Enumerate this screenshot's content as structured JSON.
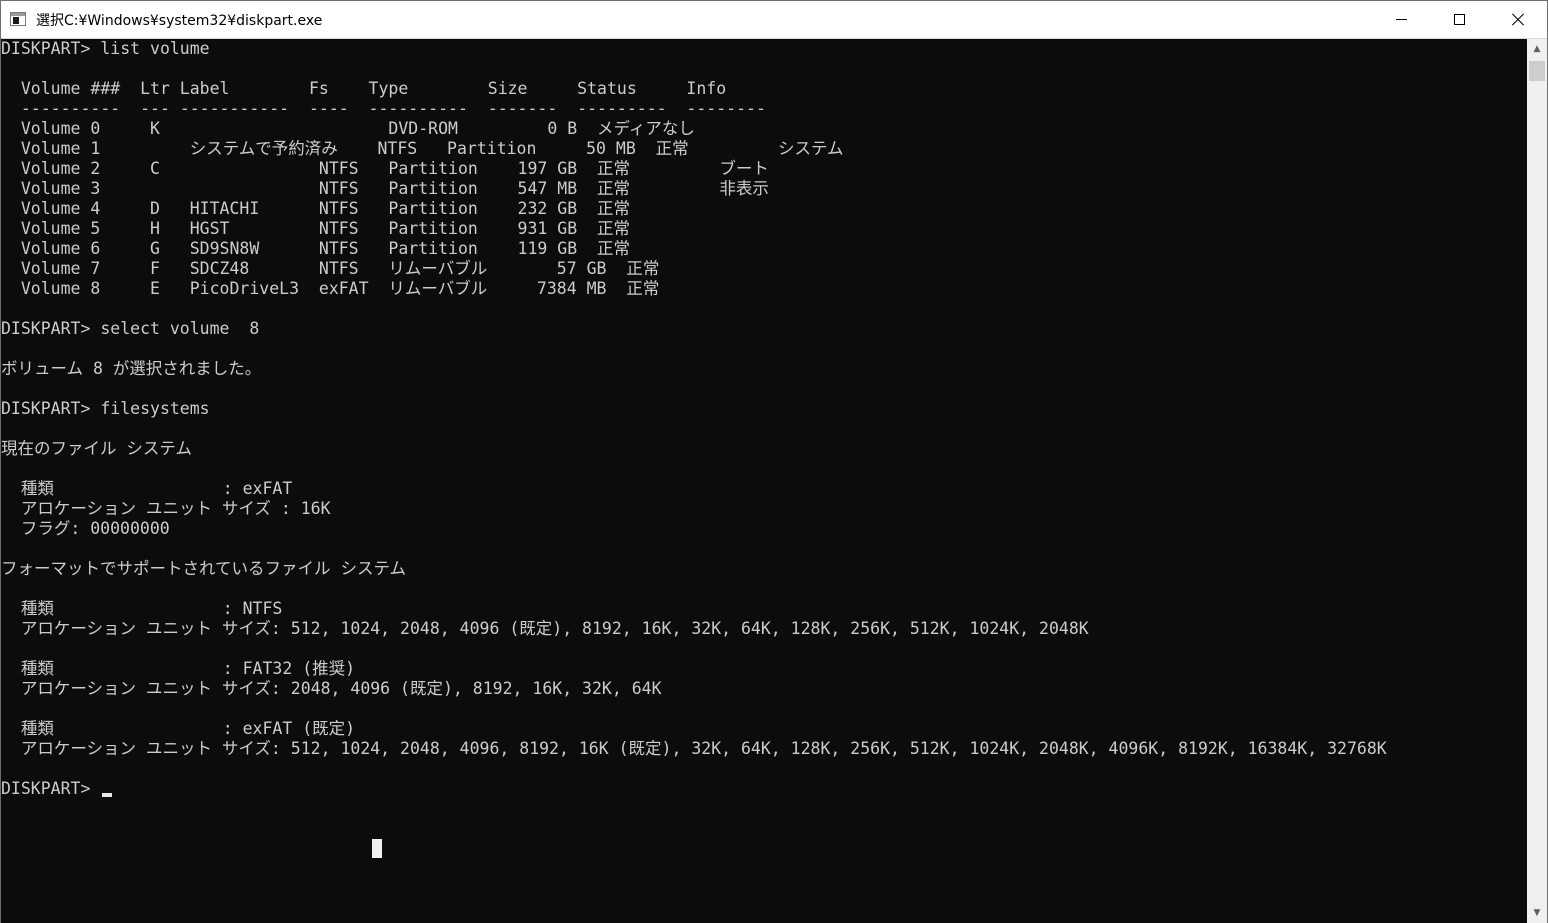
{
  "window": {
    "title": "選択C:¥Windows¥system32¥diskpart.exe"
  },
  "icons": {
    "app": "console-window-icon",
    "minimize": "minimize-icon",
    "maximize": "maximize-icon",
    "close": "close-icon",
    "scroll_up": "chevron-up-icon",
    "scroll_down": "chevron-down-icon"
  },
  "console": {
    "lines": [
      "DISKPART> list volume",
      "",
      "  Volume ###  Ltr Label        Fs    Type        Size     Status     Info",
      "  ----------  --- -----------  ----  ----------  -------  ---------  --------",
      "  Volume 0     K                       DVD-ROM         0 B  メディアなし",
      "  Volume 1         システムで予約済み    NTFS   Partition     50 MB  正常         システム",
      "  Volume 2     C                NTFS   Partition    197 GB  正常         ブート",
      "  Volume 3                      NTFS   Partition    547 MB  正常         非表示",
      "  Volume 4     D   HITACHI      NTFS   Partition    232 GB  正常",
      "  Volume 5     H   HGST         NTFS   Partition    931 GB  正常",
      "  Volume 6     G   SD9SN8W      NTFS   Partition    119 GB  正常",
      "  Volume 7     F   SDCZ48       NTFS   リムーバブル       57 GB  正常",
      "  Volume 8     E   PicoDriveL3  exFAT  リムーバブル     7384 MB  正常",
      "",
      "DISKPART> select volume  8",
      "",
      "ボリューム 8 が選択されました。",
      "",
      "DISKPART> filesystems",
      "",
      "現在のファイル システム",
      "",
      "  種類                 : exFAT",
      "  アロケーション ユニット サイズ : 16K",
      "  フラグ: 00000000",
      "",
      "フォーマットでサポートされているファイル システム",
      "",
      "  種類                 : NTFS",
      "  アロケーション ユニット サイズ: 512, 1024, 2048, 4096 (既定), 8192, 16K, 32K, 64K, 128K, 256K, 512K, 1024K, 2048K",
      "",
      "  種類                 : FAT32 (推奨)",
      "  アロケーション ユニット サイズ: 2048, 4096 (既定), 8192, 16K, 32K, 64K",
      "",
      "  種類                 : exFAT (既定)",
      "  アロケーション ユニット サイズ: 512, 1024, 2048, 4096, 8192, 16K (既定), 32K, 64K, 128K, 256K, 512K, 1024K, 2048K, 4096K, 8192K, 16384K, 32768K",
      "",
      "DISKPART> "
    ]
  },
  "colors": {
    "console_bg": "#0c0c0c",
    "console_fg": "#cccccc",
    "titlebar_bg": "#ffffff",
    "scrollbar_bg": "#f0f0f0"
  }
}
